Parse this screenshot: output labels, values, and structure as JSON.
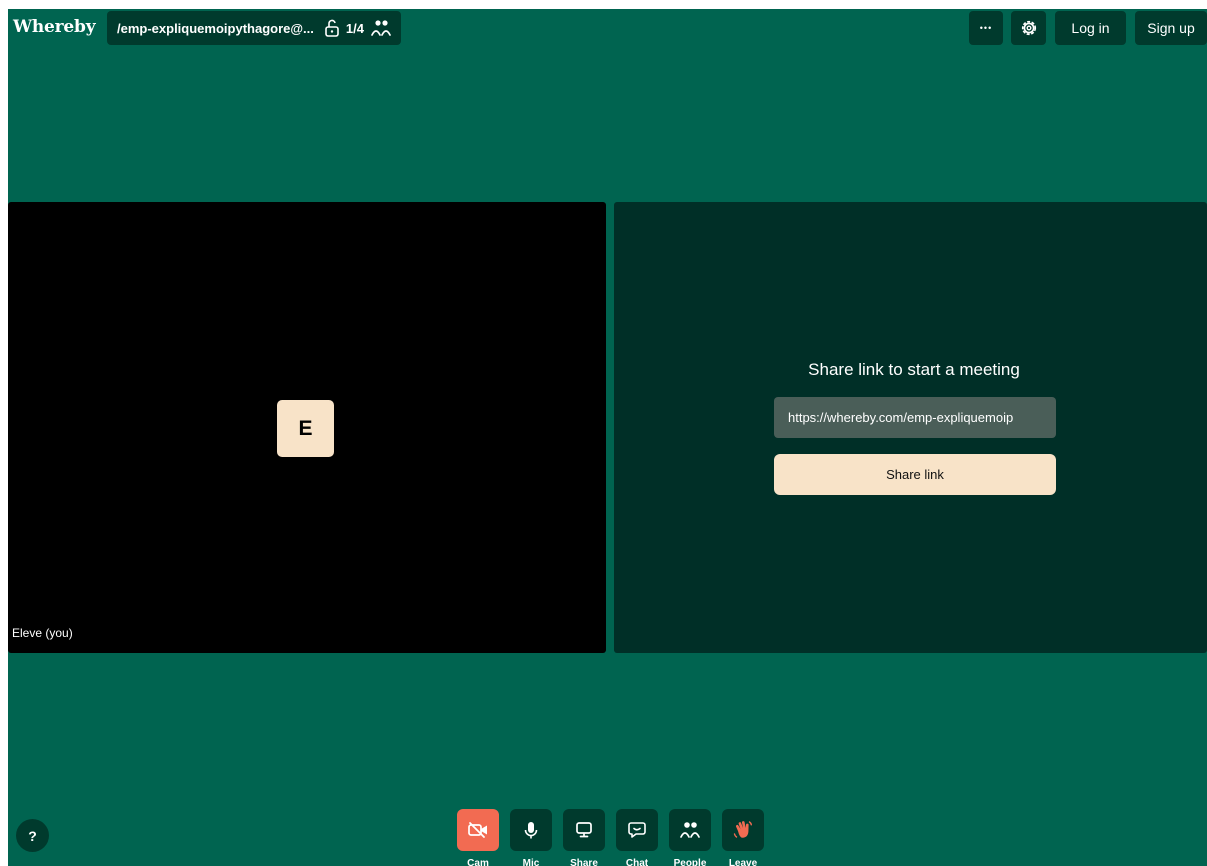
{
  "header": {
    "logo": "Whereby",
    "room_name": "/emp-expliquemoipythagore@...",
    "participant_count": "1/4",
    "login_label": "Log in",
    "signup_label": "Sign up",
    "more_label": "•••"
  },
  "self_tile": {
    "avatar_initial": "E",
    "name_label": "Eleve (you)"
  },
  "share_panel": {
    "title": "Share link to start a meeting",
    "url": "https://whereby.com/emp-expliquemoip",
    "button_label": "Share link"
  },
  "toolbar": {
    "items": [
      {
        "label": "Cam",
        "icon": "camera-off-icon"
      },
      {
        "label": "Mic",
        "icon": "microphone-icon"
      },
      {
        "label": "Share",
        "icon": "screen-share-icon"
      },
      {
        "label": "Chat",
        "icon": "chat-icon"
      },
      {
        "label": "People",
        "icon": "people-icon"
      },
      {
        "label": "Leave",
        "icon": "wave-hand-icon"
      }
    ]
  },
  "help_label": "?",
  "colors": {
    "background": "#006450",
    "dark_button": "#003a2d",
    "cam_off_accent": "#f26b52",
    "cream": "#f8e3c8"
  }
}
